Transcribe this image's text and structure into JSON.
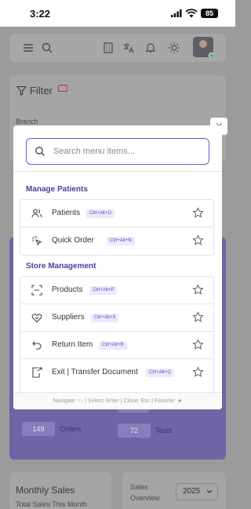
{
  "status_bar": {
    "time": "3:22",
    "battery": "85"
  },
  "background": {
    "filter": {
      "title": "Filter",
      "branch_label": "Branch"
    },
    "stats": {
      "orders_value": "149",
      "orders_label": "Orders",
      "tests_value": "72",
      "tests_label": "Tests"
    },
    "sales": {
      "title": "Monthly Sales",
      "subtitle": "Total Sales This Month",
      "overview_label": "Sales Overview",
      "year": "2025"
    }
  },
  "search": {
    "placeholder": "Search menu items..."
  },
  "sections": [
    {
      "title": "Manage Patients",
      "items": [
        {
          "label": "Patients",
          "shortcut": "Ctrl+Alt+O",
          "icon": "users-icon"
        },
        {
          "label": "Quick Order",
          "shortcut": "Ctrl+Alt+N",
          "icon": "sparkle-click-icon"
        }
      ]
    },
    {
      "title": "Store Management",
      "items": [
        {
          "label": "Products",
          "shortcut": "Ctrl+Alt+P",
          "icon": "scan-icon"
        },
        {
          "label": "Suppliers",
          "shortcut": "Ctrl+Alt+S",
          "icon": "handshake-icon"
        },
        {
          "label": "Return Item",
          "shortcut": "Ctrl+Alt+R",
          "icon": "return-arrow-icon"
        },
        {
          "label": "Exit | Transfer Document",
          "shortcut": "Ctrl+Alt+Q",
          "icon": "document-export-icon"
        }
      ]
    }
  ],
  "footer": {
    "hint": "Navigate: ↑↓ | Select: Enter | Close: Esc | Favorite: ★"
  },
  "colors": {
    "accent": "#6a5acd",
    "section_title": "#4a3fa0",
    "shortcut_bg": "#ece9fb"
  }
}
